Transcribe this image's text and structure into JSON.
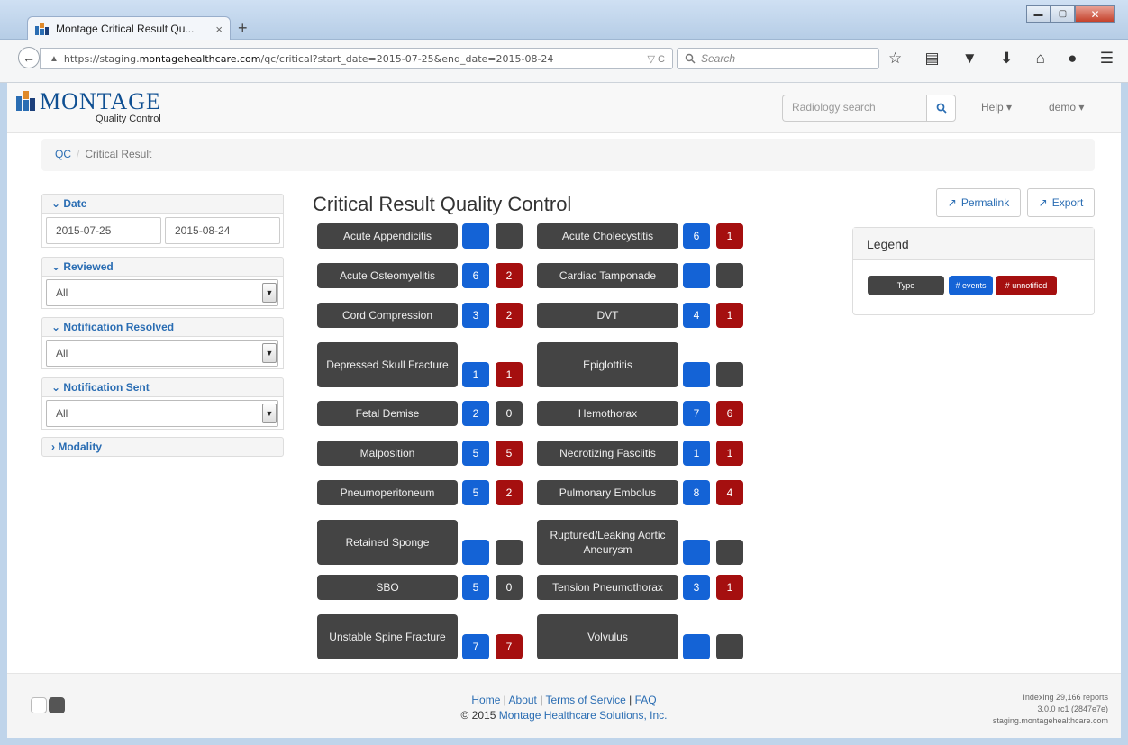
{
  "browser": {
    "tab_title": "Montage Critical Result Qu...",
    "tab_close": "×",
    "new_tab": "+",
    "url_prefix": "https://staging.",
    "url_domain": "montagehealthcare.com",
    "url_path": "/qc/critical?start_date=2015-07-25&end_date=2015-08-24",
    "url_tools": "▽ C",
    "search_placeholder": "Search",
    "win_min": "▬",
    "win_max": "▢",
    "win_close": "✕"
  },
  "app": {
    "logo_text": "MONTAGE",
    "logo_sub": "Quality Control",
    "search_placeholder": "Radiology search",
    "help_label": "Help ▾",
    "user_label": "demo ▾"
  },
  "breadcrumb": {
    "root": "QC",
    "separator": "/",
    "current": "Critical Result"
  },
  "filters": {
    "date": {
      "label": "Date",
      "start": "2015-07-25",
      "end": "2015-08-24"
    },
    "reviewed": {
      "label": "Reviewed",
      "value": "All"
    },
    "resolved": {
      "label": "Notification Resolved",
      "value": "All"
    },
    "sent": {
      "label": "Notification Sent",
      "value": "All"
    },
    "modality": {
      "label": "Modality"
    }
  },
  "main": {
    "title": "Critical Result Quality Control",
    "permalink": "Permalink",
    "export": "Export"
  },
  "legend": {
    "title": "Legend",
    "type": "Type",
    "events": "# events",
    "unnotified": "# unnotified"
  },
  "results_left": [
    {
      "type": "Acute Appendicitis",
      "events": "",
      "unnotified": ""
    },
    {
      "type": "Acute Osteomyelitis",
      "events": "6",
      "unnotified": "2"
    },
    {
      "type": "Cord Compression",
      "events": "3",
      "unnotified": "2"
    },
    {
      "type": "Depressed Skull Fracture",
      "events": "1",
      "unnotified": "1"
    },
    {
      "type": "Fetal Demise",
      "events": "2",
      "unnotified": "0"
    },
    {
      "type": "Malposition",
      "events": "5",
      "unnotified": "5"
    },
    {
      "type": "Pneumoperitoneum",
      "events": "5",
      "unnotified": "2"
    },
    {
      "type": "Retained Sponge",
      "events": "",
      "unnotified": ""
    },
    {
      "type": "SBO",
      "events": "5",
      "unnotified": "0"
    },
    {
      "type": "Unstable Spine Fracture",
      "events": "7",
      "unnotified": "7"
    }
  ],
  "results_right": [
    {
      "type": "Acute Cholecystitis",
      "events": "6",
      "unnotified": "1"
    },
    {
      "type": "Cardiac Tamponade",
      "events": "",
      "unnotified": ""
    },
    {
      "type": "DVT",
      "events": "4",
      "unnotified": "1"
    },
    {
      "type": "Epiglottitis",
      "events": "",
      "unnotified": ""
    },
    {
      "type": "Hemothorax",
      "events": "7",
      "unnotified": "6"
    },
    {
      "type": "Necrotizing Fasciitis",
      "events": "1",
      "unnotified": "1"
    },
    {
      "type": "Pulmonary Embolus",
      "events": "8",
      "unnotified": "4"
    },
    {
      "type": "Ruptured/Leaking Aortic Aneurysm",
      "events": "",
      "unnotified": ""
    },
    {
      "type": "Tension Pneumothorax",
      "events": "3",
      "unnotified": "1"
    },
    {
      "type": "Volvulus",
      "events": "",
      "unnotified": ""
    }
  ],
  "footer": {
    "home": "Home",
    "about": "About",
    "terms": "Terms of Service",
    "faq": "FAQ",
    "copyright": "© 2015",
    "company": "Montage Healthcare Solutions, Inc.",
    "indexing": "Indexing 29,166 reports",
    "version": "3.0.0 rc1 (2847e7e)",
    "host": "staging.montagehealthcare.com"
  },
  "colors": {
    "events": "#1463d6",
    "unnotified": "#a50f0f",
    "type": "#444444",
    "link": "#2a6db3"
  }
}
